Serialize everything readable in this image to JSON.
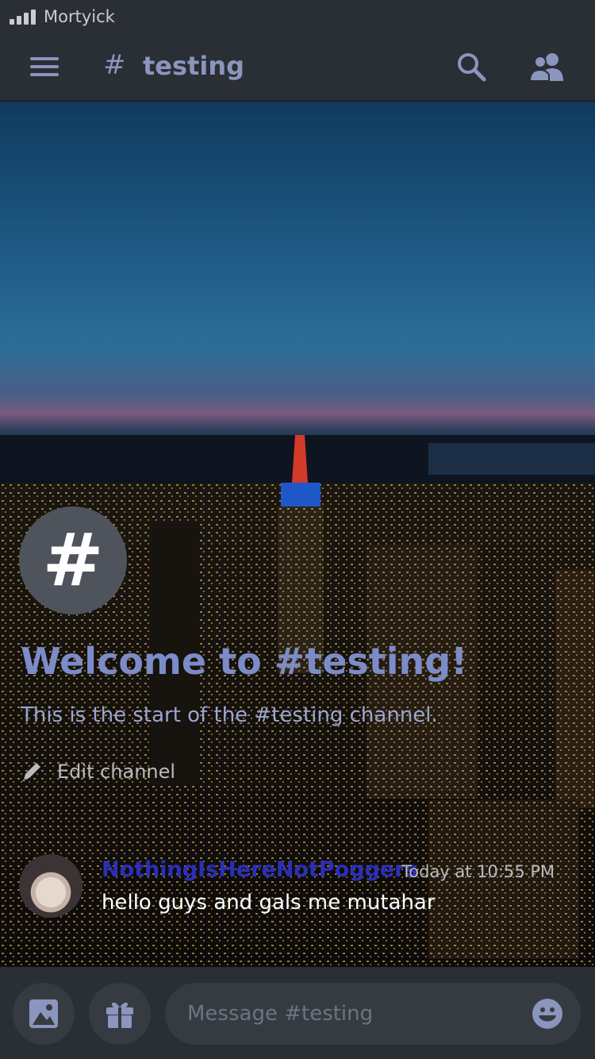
{
  "status_bar": {
    "carrier": "Mortyick"
  },
  "header": {
    "hash": "#",
    "channel_name": "testing"
  },
  "welcome": {
    "avatar_glyph": "#",
    "title": "Welcome to #testing!",
    "subtitle": "This is the start of the #testing channel.",
    "edit_label": "Edit channel"
  },
  "message": {
    "author": "NothingIsHereNotPoggers",
    "timestamp": "Today at 10:55 PM",
    "text": "hello guys and gals me mutahar"
  },
  "composer": {
    "placeholder": "Message #testing"
  },
  "icons": {
    "menu": "hamburger-icon",
    "search": "search-icon",
    "members": "members-icon",
    "image": "image-icon",
    "gift": "gift-icon",
    "emoji": "emoji-icon",
    "edit": "pencil-icon"
  },
  "colors": {
    "accent": "#8b95bd",
    "welcome_title": "#7c8cc8",
    "author": "#2b2fb8",
    "background": "#2a2e35"
  }
}
